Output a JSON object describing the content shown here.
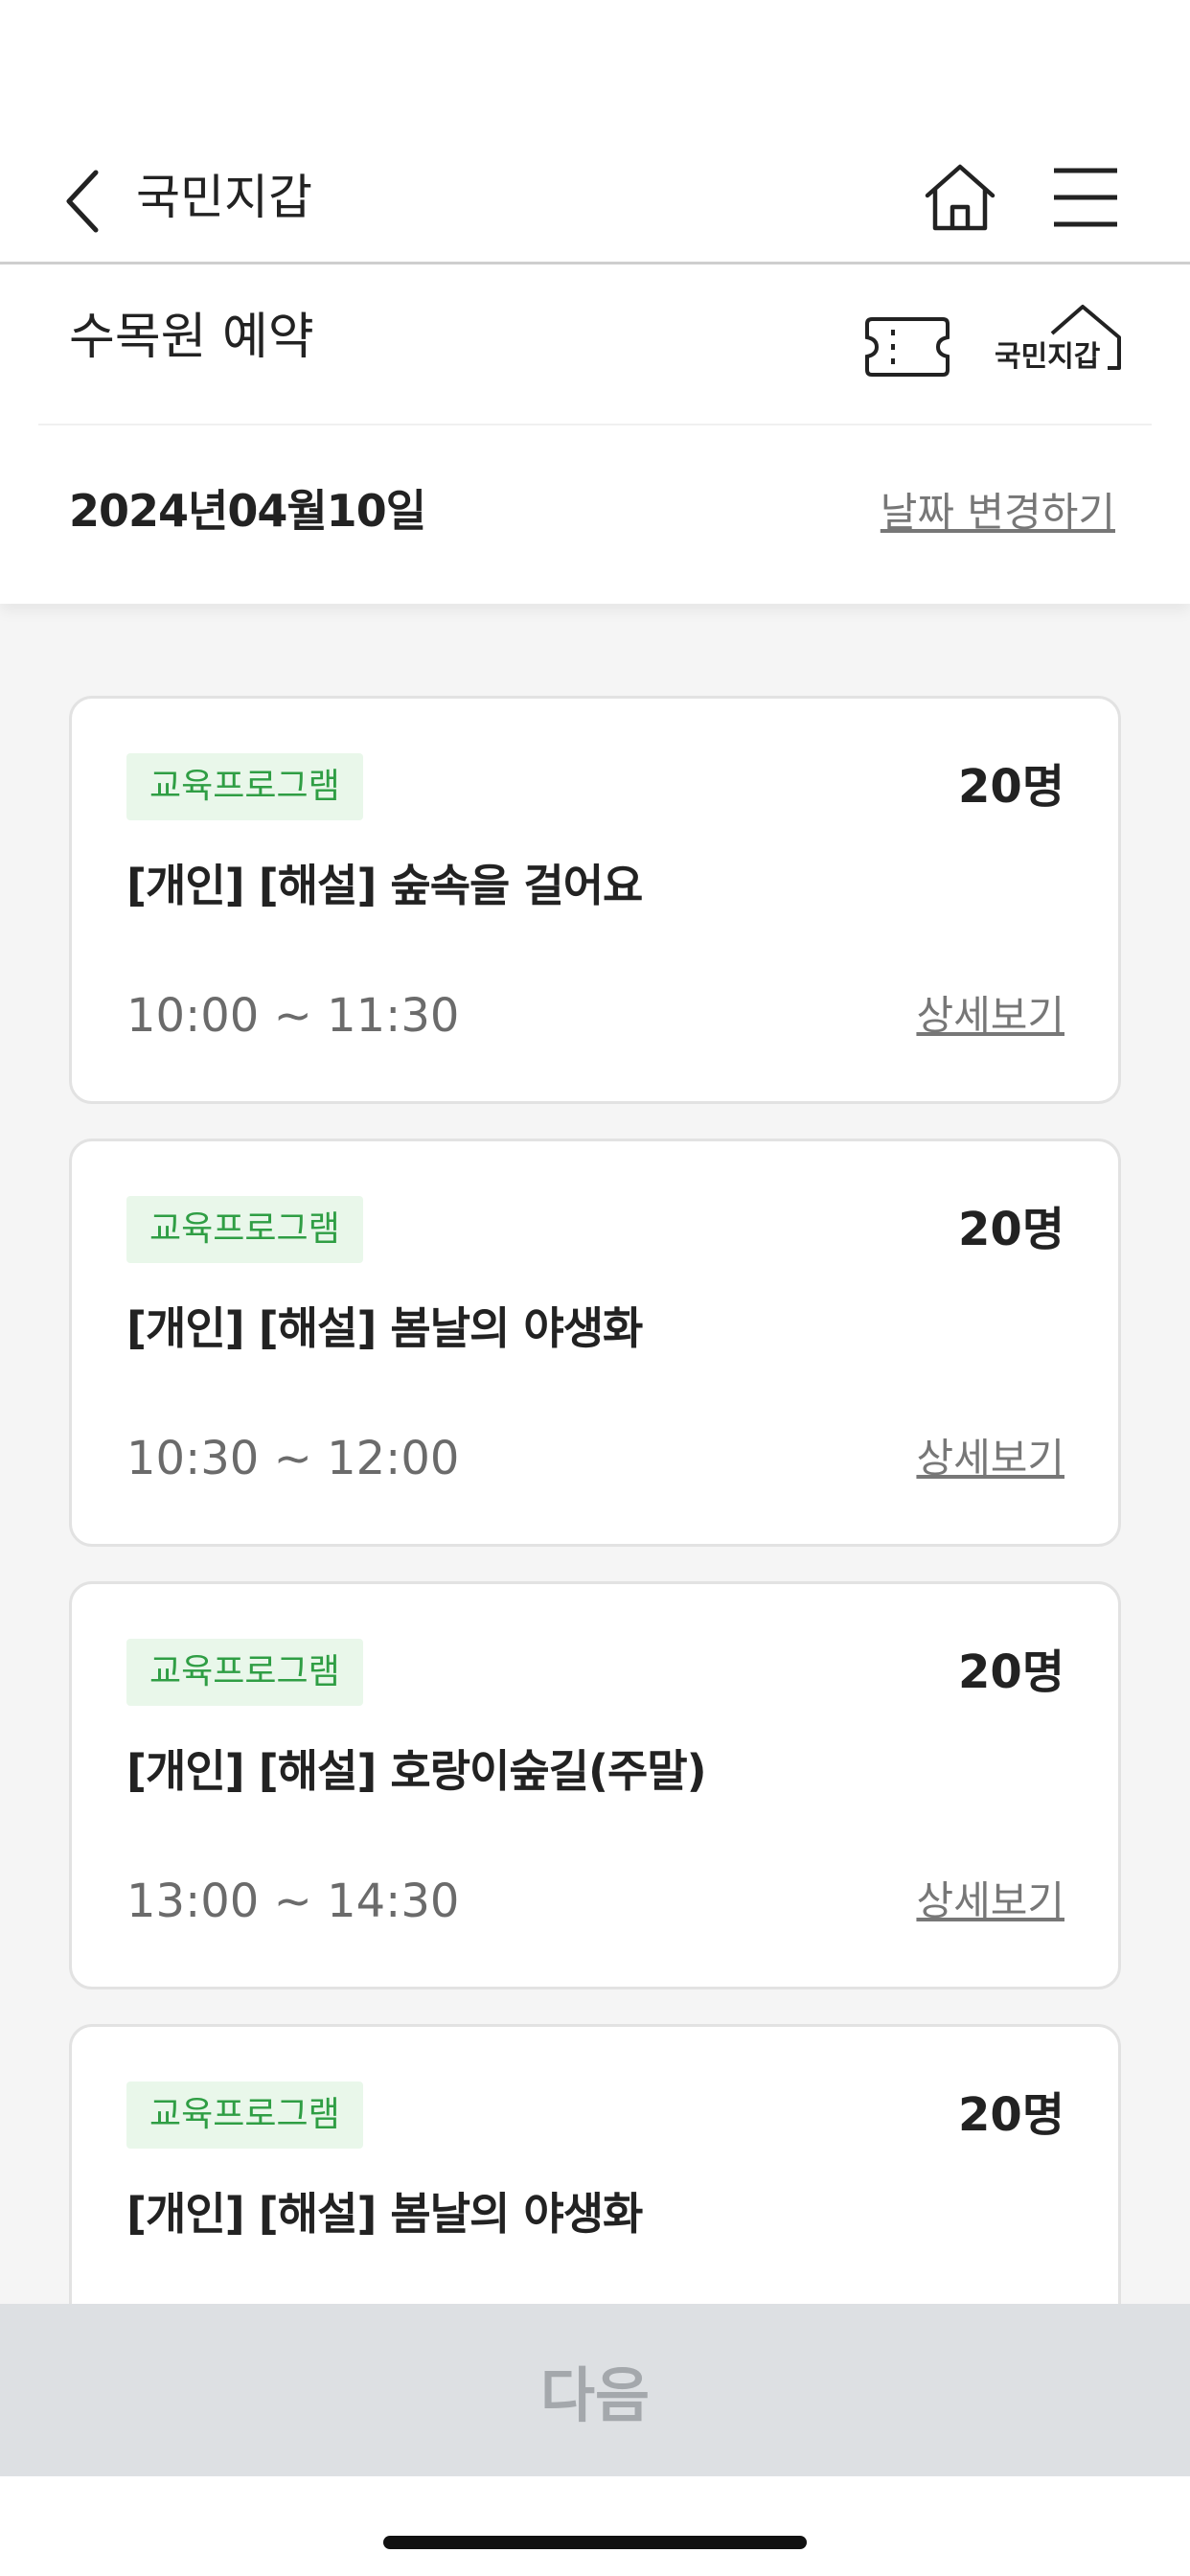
{
  "nav": {
    "title": "국민지갑",
    "back_icon": "chevron-left-icon",
    "home_icon": "home-icon",
    "menu_icon": "hamburger-menu-icon"
  },
  "header": {
    "title": "수목원 예약",
    "ticket_icon": "ticket-icon",
    "logo_text": "국민지갑",
    "date": "2024년04월10일",
    "change_date_label": "날짜 변경하기"
  },
  "programs": [
    {
      "badge": "교육프로그램",
      "capacity": "20명",
      "title": "[개인] [해설] 숲속을 걸어요",
      "time": "10:00 ~ 11:30",
      "detail_label": "상세보기"
    },
    {
      "badge": "교육프로그램",
      "capacity": "20명",
      "title": "[개인] [해설] 봄날의 야생화",
      "time": "10:30 ~ 12:00",
      "detail_label": "상세보기"
    },
    {
      "badge": "교육프로그램",
      "capacity": "20명",
      "title": "[개인] [해설] 호랑이숲길(주말)",
      "time": "13:00 ~ 14:30",
      "detail_label": "상세보기"
    },
    {
      "badge": "교육프로그램",
      "capacity": "20명",
      "title": "[개인] [해설] 봄날의 야생화",
      "time": "",
      "detail_label": ""
    }
  ],
  "footer": {
    "next_label": "다음"
  },
  "colors": {
    "badge_bg": "#e9f7ea",
    "badge_text": "#2f9e44",
    "button_disabled_bg": "#dde0e3",
    "button_disabled_text": "#a4a8ac"
  }
}
